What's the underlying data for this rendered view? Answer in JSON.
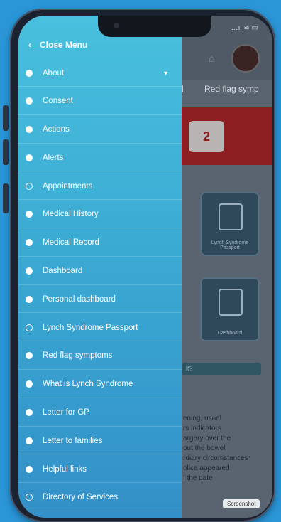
{
  "status_bar": {
    "signal": "…ıl ≋ ▭"
  },
  "background_app": {
    "tabs": [
      "l",
      "Red flag symp"
    ],
    "badge_number": "2",
    "tiles": [
      {
        "caption": "Lynch Syndrome Passport"
      },
      {
        "caption": "Dashboard"
      }
    ],
    "banner_text": "lt?",
    "paragraph": "ening, usual\nrs indicators\nargery over the\n out the bowel\nrdiary circumstances\nolica appeared\nf the date",
    "screenshot_tag": "Screenshot"
  },
  "drawer": {
    "header": {
      "label": "Close Menu"
    },
    "items": [
      {
        "label": "About",
        "marker": "filled",
        "expandable": true
      },
      {
        "label": "Consent",
        "marker": "filled"
      },
      {
        "label": "Actions",
        "marker": "filled"
      },
      {
        "label": "Alerts",
        "marker": "filled"
      },
      {
        "label": "Appointments",
        "marker": "hollow"
      },
      {
        "label": "Medical History",
        "marker": "filled"
      },
      {
        "label": "Medical Record",
        "marker": "filled"
      },
      {
        "label": "Dashboard",
        "marker": "filled"
      },
      {
        "label": "Personal dashboard",
        "marker": "filled"
      },
      {
        "label": "Lynch Syndrome Passport",
        "marker": "hollow"
      },
      {
        "label": "Red flag symptoms",
        "marker": "filled"
      },
      {
        "label": "What is Lynch Syndrome",
        "marker": "filled"
      },
      {
        "label": "Letter for GP",
        "marker": "filled"
      },
      {
        "label": "Letter to families",
        "marker": "filled"
      },
      {
        "label": "Helpful links",
        "marker": "filled"
      },
      {
        "label": "Directory of Services",
        "marker": "hollow"
      }
    ]
  }
}
